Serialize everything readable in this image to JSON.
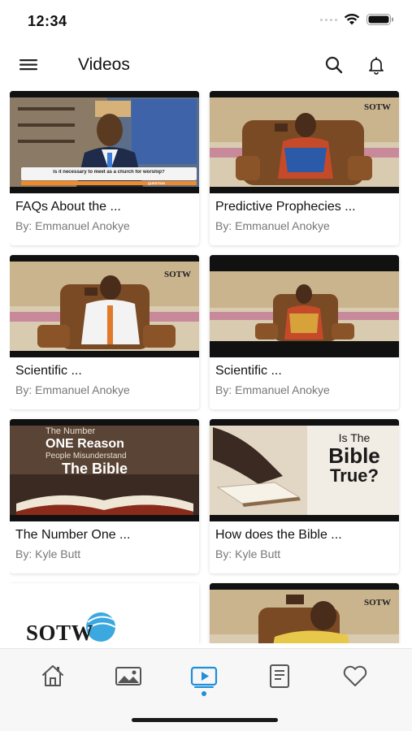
{
  "status_bar": {
    "time": "12:34"
  },
  "header": {
    "title": "Videos"
  },
  "videos": [
    {
      "title": "FAQs About the ...",
      "author": "By: Emmanuel Anokye",
      "overlay_text": "Is it necessary to meet as a church for worship?",
      "overlay_tag": "QUESTION"
    },
    {
      "title": "Predictive Prophecies ...",
      "author": "By: Emmanuel Anokye",
      "logo": "SOTW"
    },
    {
      "title": "Scientific ...",
      "author": "By: Emmanuel Anokye",
      "logo": "SOTW"
    },
    {
      "title": "Scientific ...",
      "author": "By: Emmanuel Anokye"
    },
    {
      "title": "The Number One ...",
      "author": "By: Kyle Butt",
      "thumb_lines": [
        "The Number",
        "ONE Reason",
        "People Misunderstand",
        "The Bible"
      ]
    },
    {
      "title": "How does the Bible ...",
      "author": "By: Kyle Butt",
      "thumb_lines": [
        "Is The",
        "Bible",
        "True?"
      ]
    },
    {
      "title": "",
      "author": "",
      "logo": "SOTW"
    },
    {
      "title": "",
      "author": "",
      "logo": "SOTW"
    }
  ],
  "bottom_nav": [
    {
      "name": "home",
      "icon": "home-icon",
      "active": false
    },
    {
      "name": "gallery",
      "icon": "image-icon",
      "active": false
    },
    {
      "name": "videos",
      "icon": "video-icon",
      "active": true
    },
    {
      "name": "articles",
      "icon": "document-icon",
      "active": false
    },
    {
      "name": "favorites",
      "icon": "heart-icon",
      "active": false
    }
  ],
  "colors": {
    "accent": "#1e8fd8",
    "inactive_icon": "#444444"
  }
}
